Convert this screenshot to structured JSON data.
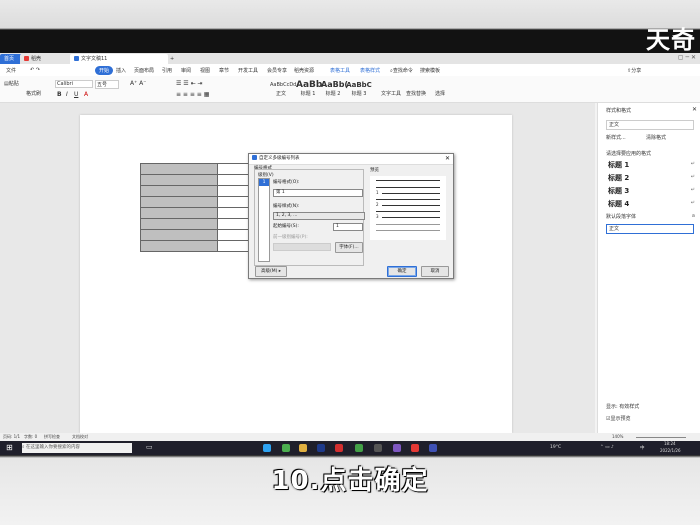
{
  "brand": "天奇",
  "subtitle": "10.点击确定",
  "tabs": {
    "home": "首页",
    "file1": "稻壳",
    "file2": "文字文稿11",
    "add": "+"
  },
  "menu": [
    "文件",
    "开始",
    "插入",
    "页面布局",
    "引用",
    "审阅",
    "视图",
    "章节",
    "开发工具",
    "会员专享",
    "稻壳资源",
    "表格工具",
    "表格样式"
  ],
  "menu_right": [
    "查找命令",
    "搜索模板"
  ],
  "share": "分享",
  "ribbon": {
    "paste": "粘贴",
    "format_painter": "格式刷",
    "font": "Calibri",
    "size": "五号",
    "styles": [
      {
        "preview": "AaBbCcDd",
        "name": "正文"
      },
      {
        "preview": "AaBb",
        "name": "标题 1"
      },
      {
        "preview": "AaBb(",
        "name": "标题 2"
      },
      {
        "preview": "AaBbC",
        "name": "标题 3"
      }
    ],
    "text_tools": "文字工具",
    "find_replace": "查找替换",
    "select": "选择"
  },
  "pane": {
    "title": "样式和格式",
    "current": "正文",
    "new_style": "新样式...",
    "clear_format": "清除格式",
    "section_label": "请选择要应用的格式",
    "styles": [
      "标题 1",
      "标题 2",
      "标题 3",
      "标题 4"
    ],
    "default_para": "默认段落字体",
    "body": "正文",
    "show": "显示: 有效样式",
    "preview": "显示预览"
  },
  "dialog": {
    "title": "自定义多级编号列表",
    "format_group": "编号格式",
    "level_label": "级别(V)",
    "levels": [
      "1",
      "2",
      "3",
      "4",
      "5",
      "6",
      "7",
      "8",
      "9"
    ],
    "num_format_label": "编号格式(O):",
    "num_format_value": "第 1",
    "num_style_label": "编号样式(N):",
    "num_style_value": "1, 2, 3, ...",
    "start_label": "起始编号(S):",
    "start_value": "1",
    "prev_level_label": "前一级别编号(P):",
    "font_button": "字体(F)...",
    "preview_label": "预览",
    "preview_items": [
      "1",
      "2",
      "3"
    ],
    "advanced_button": "高级(M) ▸",
    "ok_button": "确定",
    "cancel_button": "取消"
  },
  "status": {
    "page": "页码: 1/1",
    "words": "字数: 0",
    "spell": "拼写检查",
    "proof": "文档校对",
    "zoom": "140%"
  },
  "taskbar": {
    "search_placeholder": "在这里输入你要搜索的内容",
    "weather": "19°C",
    "time": "18:24",
    "date": "2022/1/26",
    "lang": "中"
  },
  "colors": {
    "accent": "#2f6fd6",
    "taskbar": "#1f1f2b"
  }
}
